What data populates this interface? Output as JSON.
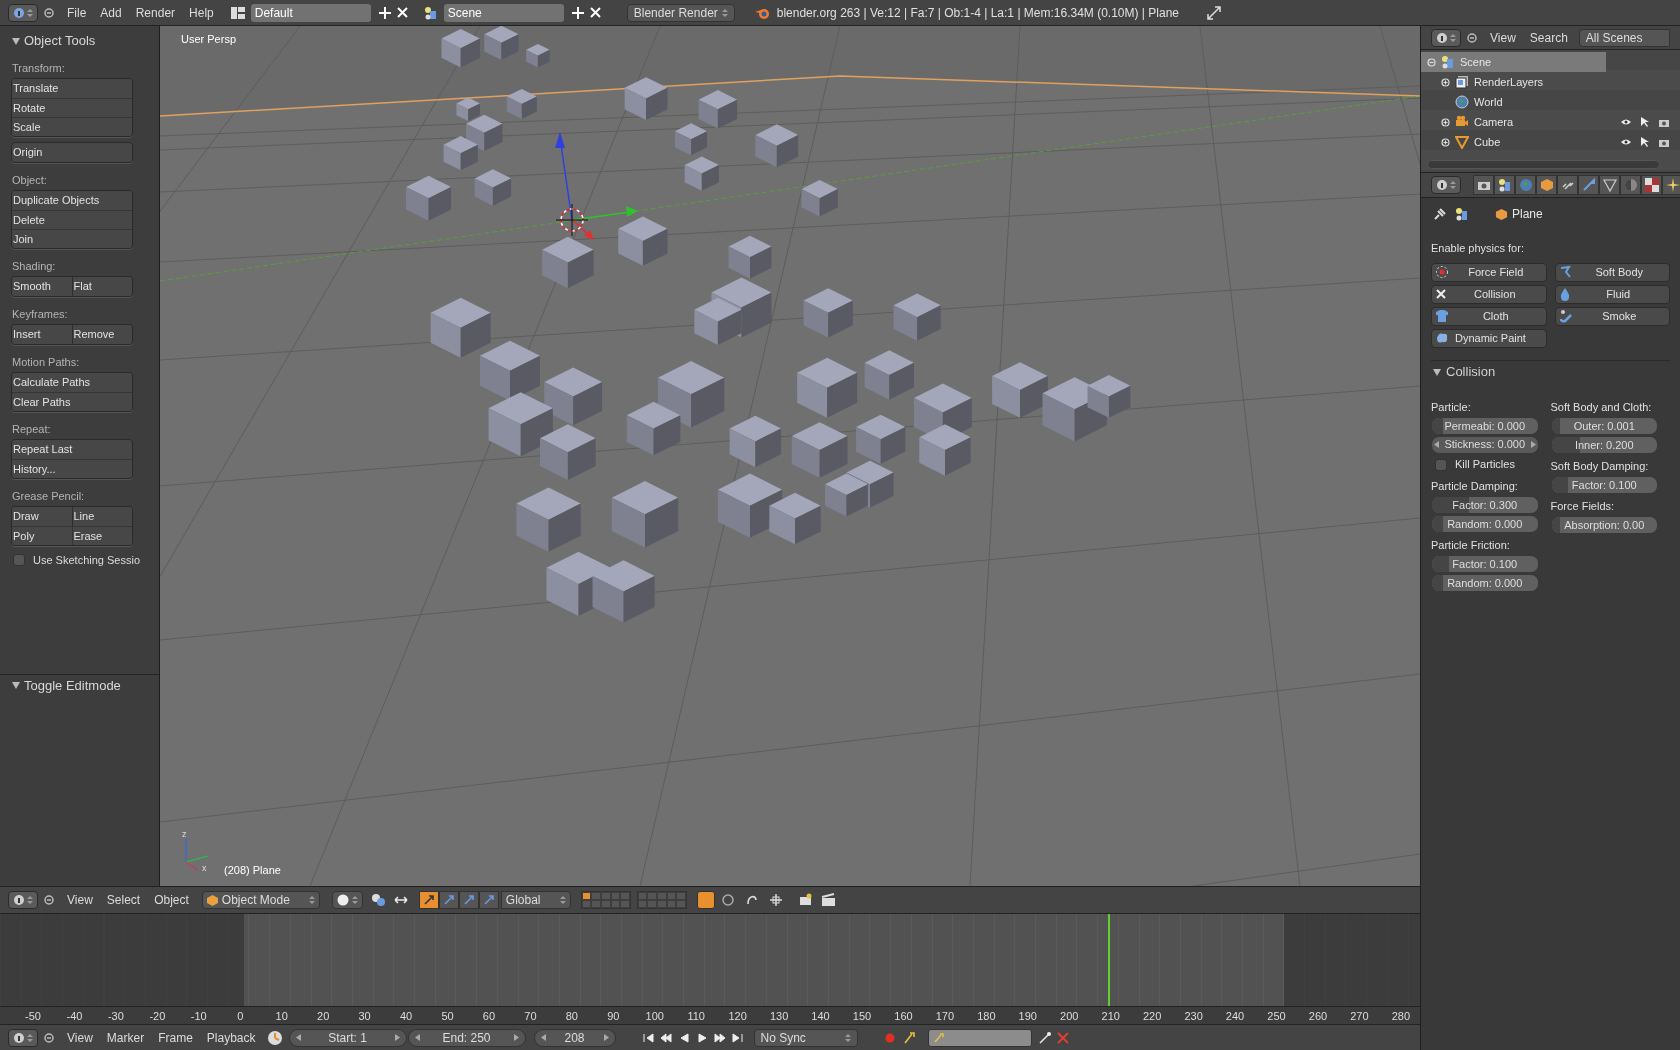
{
  "top_bar": {
    "menus": [
      "File",
      "Add",
      "Render",
      "Help"
    ],
    "layout": "Default",
    "scene": "Scene",
    "engine": "Blender Render",
    "stats": "blender.org 263 | Ve:12 | Fa:7 | Ob:1-4 | La:1 | Mem:16.34M (0.10M) | Plane"
  },
  "tool_shelf": {
    "title": "Object Tools",
    "sections": [
      {
        "label": "Transform:",
        "groups": [
          [
            [
              "Translate"
            ],
            [
              "Rotate"
            ],
            [
              "Scale"
            ]
          ],
          [
            [
              "Origin"
            ]
          ]
        ]
      },
      {
        "label": "Object:",
        "groups": [
          [
            [
              "Duplicate Objects"
            ],
            [
              "Delete"
            ],
            [
              "Join"
            ]
          ]
        ]
      },
      {
        "label": "Shading:",
        "groups": [
          [
            [
              "Smooth",
              "Flat"
            ]
          ]
        ]
      },
      {
        "label": "Keyframes:",
        "groups": [
          [
            [
              "Insert",
              "Remove"
            ]
          ]
        ]
      },
      {
        "label": "Motion Paths:",
        "groups": [
          [
            [
              "Calculate Paths"
            ],
            [
              "Clear Paths"
            ]
          ]
        ]
      },
      {
        "label": "Repeat:",
        "groups": [
          [
            [
              "Repeat Last"
            ],
            [
              "History..."
            ]
          ]
        ]
      },
      {
        "label": "Grease Pencil:",
        "groups": [
          [
            [
              "Draw",
              "Line"
            ],
            [
              "Poly",
              "Erase"
            ]
          ]
        ]
      }
    ],
    "sketching": {
      "label": "Use Sketching Sessio",
      "checked": false
    },
    "operator_panel": "Toggle Editmode"
  },
  "viewport": {
    "view_label": "User Persp",
    "object_label": "(208) Plane",
    "axis_labels": [
      "z",
      "x"
    ]
  },
  "view_header": {
    "menus": [
      "View",
      "Select",
      "Object"
    ],
    "mode": "Object Mode",
    "orientation": "Global"
  },
  "timeline": {
    "level": 0.78,
    "ruler": [
      "-50",
      "-40",
      "-30",
      "-20",
      "-10",
      "0",
      "10",
      "20",
      "30",
      "40",
      "50",
      "60",
      "70",
      "80",
      "90",
      "100",
      "110",
      "120",
      "130",
      "140",
      "150",
      "160",
      "170",
      "180",
      "190",
      "200",
      "210",
      "220",
      "230",
      "240",
      "250",
      "260",
      "270",
      "280"
    ]
  },
  "timeline_header": {
    "menus": [
      "View",
      "Marker",
      "Frame",
      "Playback"
    ],
    "start": "Start: 1",
    "end": "End: 250",
    "frame": "208",
    "sync": "No Sync"
  },
  "outliner": {
    "menus": [
      "View",
      "Search"
    ],
    "filter": "All Scenes",
    "tree": [
      {
        "label": "Scene",
        "kind": "scene",
        "selected": true,
        "children": [
          {
            "label": "RenderLayers",
            "kind": "renderlayers",
            "selected": false
          },
          {
            "label": "World",
            "kind": "world",
            "selected": false
          },
          {
            "label": "Camera",
            "kind": "camera",
            "selected": false
          },
          {
            "label": "Cube",
            "kind": "mesh",
            "selected": false
          }
        ]
      }
    ]
  },
  "properties": {
    "object": "Plane",
    "enable_label": "Enable physics for:",
    "physics": [
      {
        "label": "Force Field",
        "kind": "forcefield"
      },
      {
        "label": "Soft Body",
        "kind": "softbody"
      },
      {
        "label": "Collision",
        "kind": "collision"
      },
      {
        "label": "Fluid",
        "kind": "fluid"
      },
      {
        "label": "Cloth",
        "kind": "cloth"
      },
      {
        "label": "Smoke",
        "kind": "smoke"
      },
      {
        "label": "Dynamic Paint",
        "kind": "dynamicpaint"
      }
    ],
    "panel": {
      "title": "Collision",
      "columns": [
        [
          {
            "kind": "label",
            "text": "Particle:"
          },
          {
            "kind": "slider",
            "text": "Permeabi: 0.000",
            "level": 0.1
          },
          {
            "kind": "number",
            "text": "Stickness: 0.000"
          },
          {
            "kind": "checkbox",
            "text": "Kill Particles",
            "checked": false
          },
          {
            "kind": "label",
            "text": "Particle Damping:"
          },
          {
            "kind": "slider",
            "text": "Factor: 0.300",
            "level": 0.35
          },
          {
            "kind": "slider",
            "text": "Random: 0.000",
            "level": 0.1
          },
          {
            "kind": "label",
            "text": "Particle Friction:"
          },
          {
            "kind": "slider",
            "text": "Factor: 0.100",
            "level": 0.16
          },
          {
            "kind": "slider",
            "text": "Random: 0.000",
            "level": 0.1
          }
        ],
        [
          {
            "kind": "label",
            "text": "Soft Body and Cloth:"
          },
          {
            "kind": "slider",
            "text": "Outer: 0.001",
            "level": 0.08
          },
          {
            "kind": "slider",
            "text": "Inner: 0.200",
            "level": 0.27
          },
          {
            "kind": "label",
            "text": "Soft Body Damping:"
          },
          {
            "kind": "slider",
            "text": "Factor: 0.100",
            "level": 0.16
          },
          {
            "kind": "label",
            "text": "Force Fields:"
          },
          {
            "kind": "slider",
            "text": "Absorption: 0.00",
            "level": 0.08
          }
        ]
      ]
    }
  }
}
